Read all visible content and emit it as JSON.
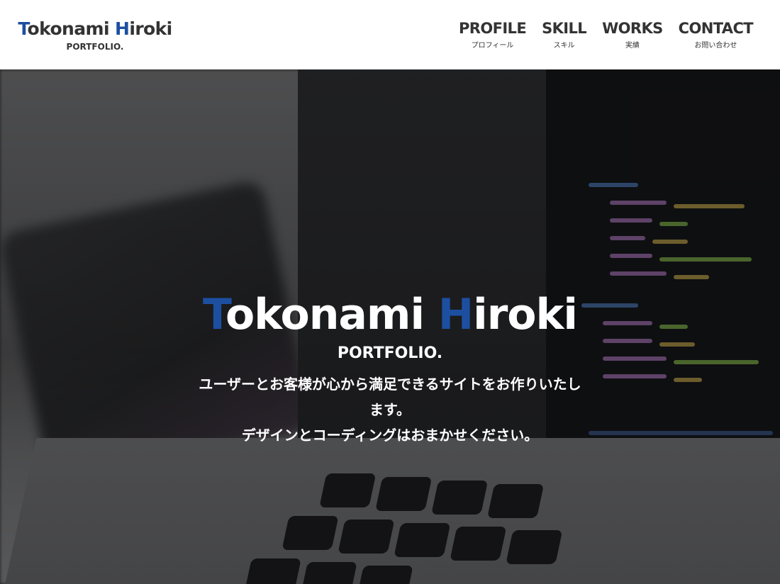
{
  "site": {
    "logo": {
      "first_initial": "T",
      "first_rest": "okonami ",
      "last_initial": "H",
      "last_rest": "iroki",
      "sub": "PORTFOLIO."
    },
    "accent_color": "#1d4fa1",
    "text_color": "#333333"
  },
  "nav": {
    "items": [
      {
        "label": "PROFILE",
        "sub": "プロフィール"
      },
      {
        "label": "SKILL",
        "sub": "スキル"
      },
      {
        "label": "WORKS",
        "sub": "実績"
      },
      {
        "label": "CONTACT",
        "sub": "お問い合わせ"
      }
    ]
  },
  "hero": {
    "title": {
      "first_initial": "T",
      "first_rest": "okonami ",
      "last_initial": "H",
      "last_rest": "iroki"
    },
    "sub": "PORTFOLIO.",
    "lines": [
      "ユーザーとお客様が心から満足できるサイトをお作りいたします。",
      "デザインとコーディングはおまかせください。"
    ],
    "background": "laptop-code-photo"
  }
}
